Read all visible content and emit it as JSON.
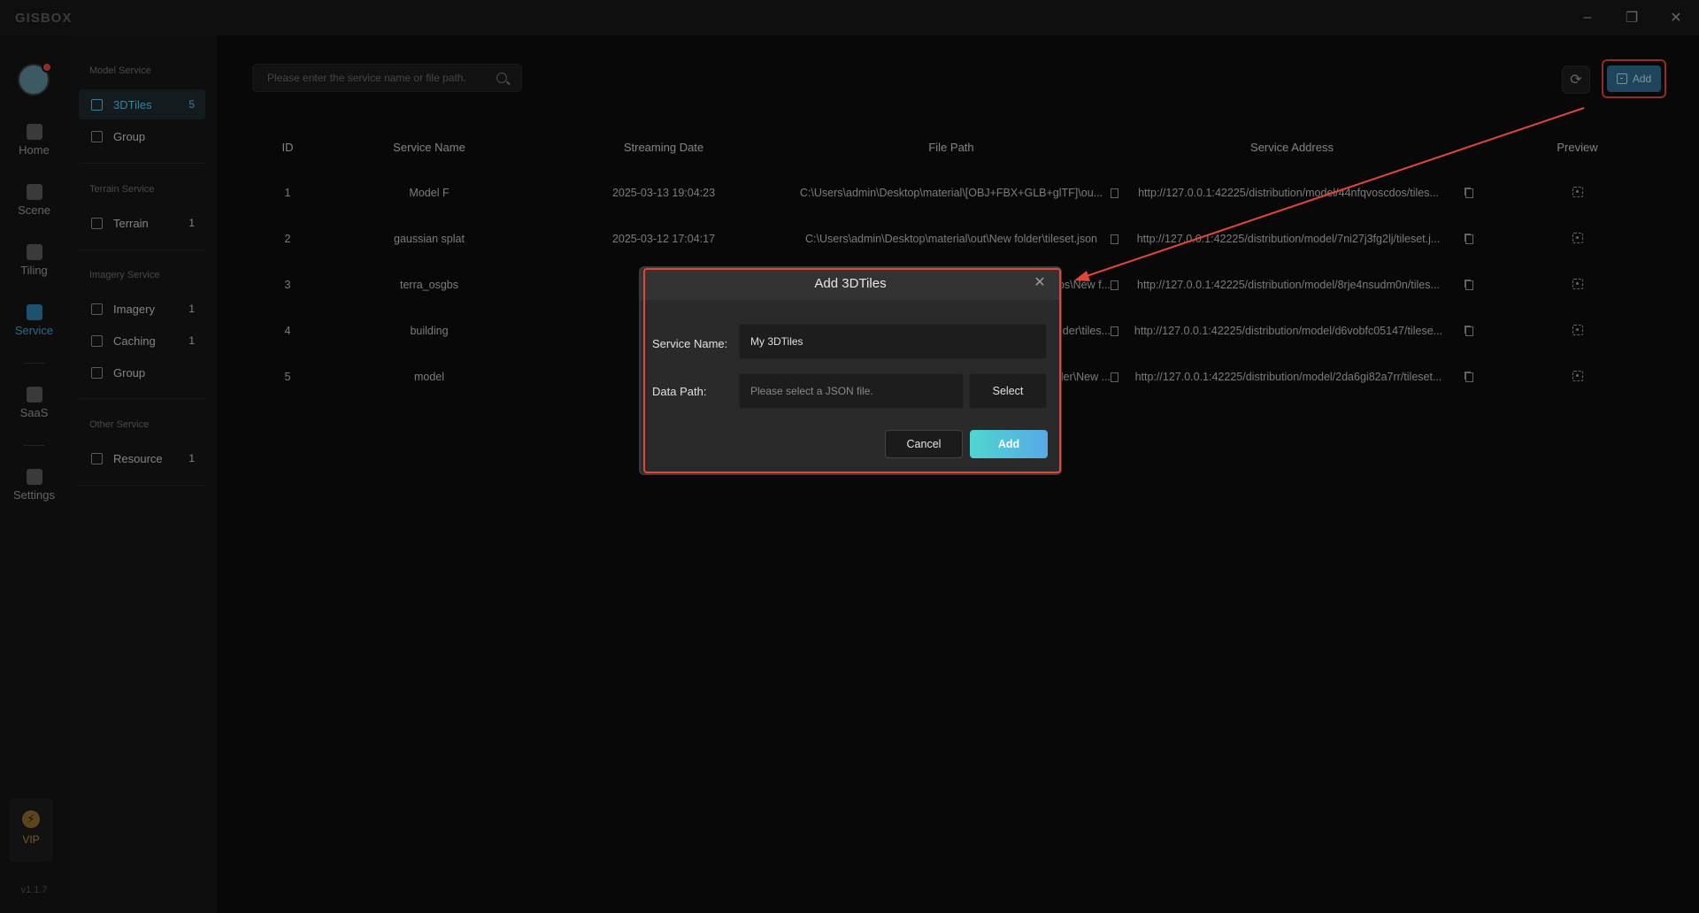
{
  "app": {
    "logo": "GISBOX",
    "version": "v1.1.7"
  },
  "window_controls": {
    "minimize": "–",
    "maximize": "❐",
    "close": "✕"
  },
  "rail": {
    "items": [
      {
        "label": "Home",
        "icon": "home-icon"
      },
      {
        "label": "Scene",
        "icon": "cube-icon"
      },
      {
        "label": "Tiling",
        "icon": "tiling-icon"
      },
      {
        "label": "Service",
        "icon": "service-icon",
        "active": true
      },
      {
        "label": "SaaS",
        "icon": "lock-icon"
      },
      {
        "label": "Settings",
        "icon": "gear-icon"
      }
    ],
    "vip_label": "VIP",
    "vip_symbol": "⚡"
  },
  "sidebar": {
    "model_title": "Model Service",
    "model_items": [
      {
        "label": "3DTiles",
        "count": "5"
      },
      {
        "label": "Group",
        "count": ""
      }
    ],
    "terrain_title": "Terrain Service",
    "terrain_items": [
      {
        "label": "Terrain",
        "count": "1"
      }
    ],
    "imagery_title": "Imagery Service",
    "imagery_items": [
      {
        "label": "Imagery",
        "count": "1"
      },
      {
        "label": "Caching",
        "count": "1"
      },
      {
        "label": "Group",
        "count": ""
      }
    ],
    "other_title": "Other Service",
    "other_items": [
      {
        "label": "Resource",
        "count": "1"
      }
    ]
  },
  "toolbar": {
    "search_placeholder": "Please enter the service name or file path.",
    "refresh_symbol": "⟳",
    "add_label": "Add"
  },
  "table": {
    "headers": [
      "ID",
      "Service Name",
      "Streaming Date",
      "File Path",
      "Service Address",
      "Preview"
    ],
    "rows": [
      {
        "id": "1",
        "name": "Model F",
        "date": "2025-03-13 19:04:23",
        "path": "C:\\Users\\admin\\Desktop\\material\\[OBJ+FBX+GLB+glTF]\\ou...",
        "address": "http://127.0.0.1:42225/distribution/model/44nfqvoscdos/tiles..."
      },
      {
        "id": "2",
        "name": "gaussian splat",
        "date": "2025-03-12 17:04:17",
        "path": "C:\\Users\\admin\\Desktop\\material\\out\\New folder\\tileset.json",
        "address": "http://127.0.0.1:42225/distribution/model/7ni27j3fg2lj/tileset.j..."
      },
      {
        "id": "3",
        "name": "terra_osgbs",
        "date": "",
        "path": "terra_osgbs\\New f...",
        "address": "http://127.0.0.1:42225/distribution/model/8rje4nsudm0n/tiles..."
      },
      {
        "id": "4",
        "name": "building",
        "date": "",
        "path": "1\\New folder\\tiles...",
        "address": "http://127.0.0.1:42225/distribution/model/d6vobfc05147/tilese..."
      },
      {
        "id": "5",
        "name": "model",
        "date": "",
        "path": ")\\New folder\\New ...",
        "address": "http://127.0.0.1:42225/distribution/model/2da6gi82a7rr/tileset..."
      }
    ]
  },
  "modal": {
    "title": "Add 3DTiles",
    "close_symbol": "✕",
    "service_name_label": "Service Name:",
    "service_name_value": "My 3DTiles",
    "data_path_label": "Data Path:",
    "data_path_placeholder": "Please select a JSON file.",
    "select_label": "Select",
    "cancel_label": "Cancel",
    "submit_label": "Add"
  },
  "colors": {
    "accent": "#3ba3d9",
    "highlight": "#e0463a",
    "primary_gradient_start": "#4fd6d0",
    "primary_gradient_end": "#58a9e6"
  }
}
